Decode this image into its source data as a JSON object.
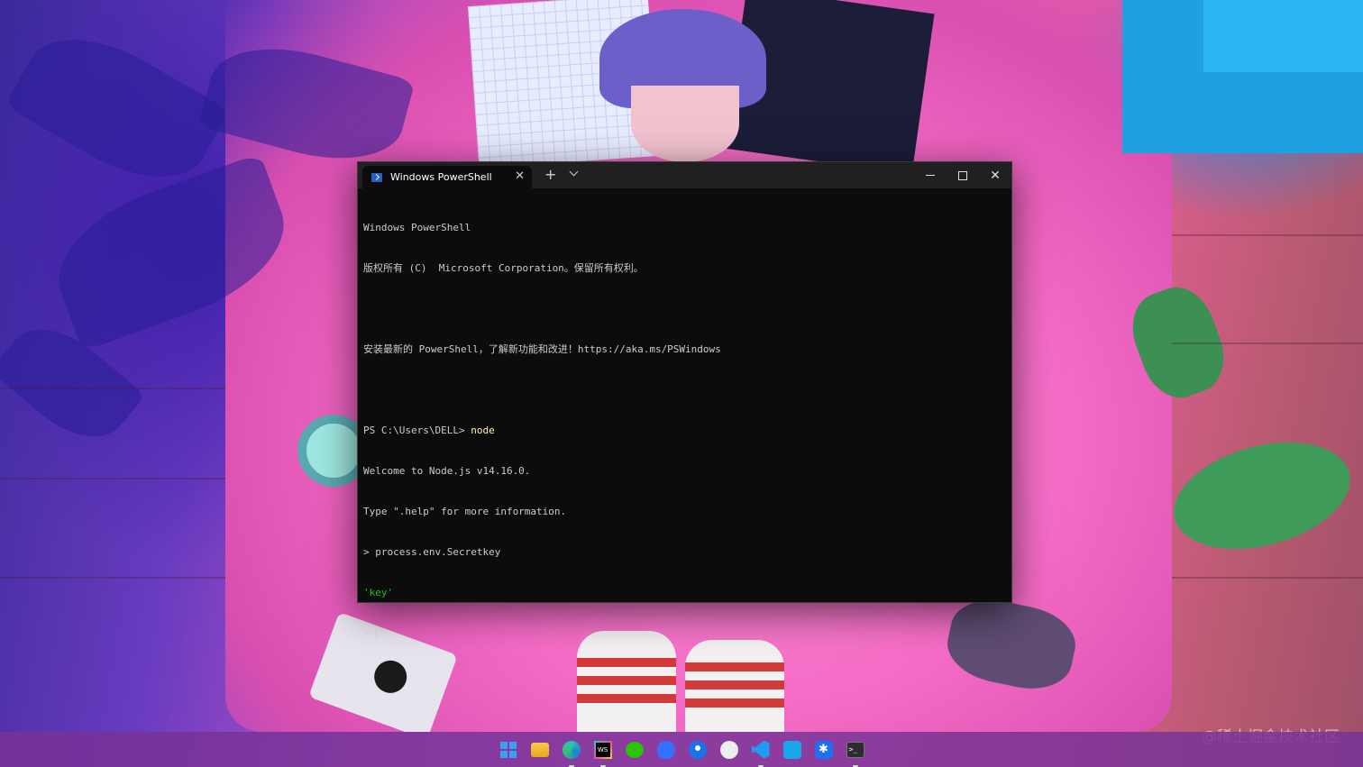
{
  "watermark": "@稀土掘金技术社区",
  "terminal": {
    "tab_title": "Windows PowerShell",
    "tab_icon": "powershell-icon",
    "colors": {
      "background": "#0c0c0c",
      "titlebar": "#202020",
      "text": "#cccccc",
      "command": "#f9f1a5",
      "string": "#16c60c"
    },
    "lines": [
      {
        "text": "Windows PowerShell"
      },
      {
        "text": "版权所有 (C)  Microsoft Corporation。保留所有权利。"
      },
      {
        "text": ""
      },
      {
        "text": "安装最新的 PowerShell，了解新功能和改进！https://aka.ms/PSWindows"
      },
      {
        "text": ""
      },
      {
        "prompt": "PS C:\\Users\\DELL> ",
        "command": "node"
      },
      {
        "text": "Welcome to Node.js v14.16.0."
      },
      {
        "text": "Type \".help\" for more information."
      },
      {
        "text": "> process.env.Secretkey"
      },
      {
        "string": "'key'"
      },
      {
        "prompt": "> "
      }
    ]
  },
  "taskbar": {
    "icons": [
      {
        "name": "start-icon",
        "active": false
      },
      {
        "name": "file-explorer-icon",
        "active": false
      },
      {
        "name": "edge-icon",
        "active": true
      },
      {
        "name": "webstorm-icon",
        "active": true
      },
      {
        "name": "wechat-icon",
        "active": false
      },
      {
        "name": "feishu-icon",
        "active": false
      },
      {
        "name": "maps-icon",
        "active": false
      },
      {
        "name": "chat-icon",
        "active": false
      },
      {
        "name": "vscode-icon",
        "active": true
      },
      {
        "name": "translate-icon",
        "active": false
      },
      {
        "name": "star-app-icon",
        "active": false
      },
      {
        "name": "terminal-icon",
        "active": true
      }
    ]
  }
}
